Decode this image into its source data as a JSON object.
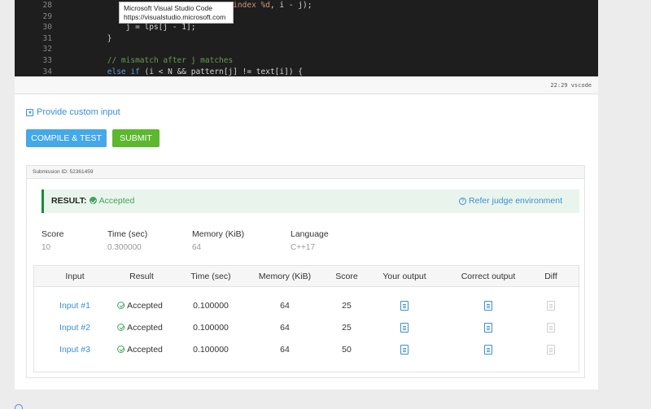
{
  "editor": {
    "line_numbers": [
      "28",
      "29",
      "30",
      "31",
      "32",
      "33",
      "34"
    ],
    "lines": [
      {
        "indent": "            ",
        "parts": [
          {
            "t": "tx",
            "v": "                    "
          },
          {
            "t": "st",
            "v": "at index %d"
          },
          {
            "t": "tx",
            "v": ", i - j);"
          }
        ]
      },
      {
        "indent": "",
        "parts": [
          {
            "t": "tx",
            "v": ""
          }
        ]
      },
      {
        "indent": "            ",
        "parts": [
          {
            "t": "tx",
            "v": "j = lps[j - 1];"
          }
        ]
      },
      {
        "indent": "        ",
        "parts": [
          {
            "t": "tx",
            "v": "}"
          }
        ]
      },
      {
        "indent": "",
        "parts": [
          {
            "t": "tx",
            "v": ""
          }
        ]
      },
      {
        "indent": "        ",
        "parts": [
          {
            "t": "cm",
            "v": "// mismatch after j matches"
          }
        ]
      },
      {
        "indent": "        ",
        "parts": [
          {
            "t": "kw",
            "v": "else if"
          },
          {
            "t": "tx",
            "v": " (i < N && pattern[j] != text[i]) {"
          }
        ]
      }
    ],
    "tooltip_title": "Microsoft Visual Studio Code",
    "tooltip_url": "https://visualstudio.microsoft.com",
    "status_text": "22:29  vscode"
  },
  "custom_input": {
    "label": "Provide custom input"
  },
  "buttons": {
    "compile": "COMPILE & TEST",
    "submit": "SUBMIT"
  },
  "submission": {
    "id_label": "Submission ID: 52361459",
    "result_label": "RESULT:",
    "result_value": "Accepted",
    "refer_label": "Refer judge environment",
    "stats": {
      "score_h": "Score",
      "score_v": "10",
      "time_h": "Time (sec)",
      "time_v": "0.300000",
      "mem_h": "Memory (KiB)",
      "mem_v": "64",
      "lang_h": "Language",
      "lang_v": "C++17"
    },
    "table": {
      "headers": [
        "Input",
        "Result",
        "Time (sec)",
        "Memory (KiB)",
        "Score",
        "Your output",
        "Correct output",
        "Diff"
      ],
      "rows": [
        {
          "input": "Input #1",
          "result": "Accepted",
          "time": "0.100000",
          "memory": "64",
          "score": "25"
        },
        {
          "input": "Input #2",
          "result": "Accepted",
          "time": "0.100000",
          "memory": "64",
          "score": "25"
        },
        {
          "input": "Input #3",
          "result": "Accepted",
          "time": "0.100000",
          "memory": "64",
          "score": "50"
        }
      ]
    }
  }
}
